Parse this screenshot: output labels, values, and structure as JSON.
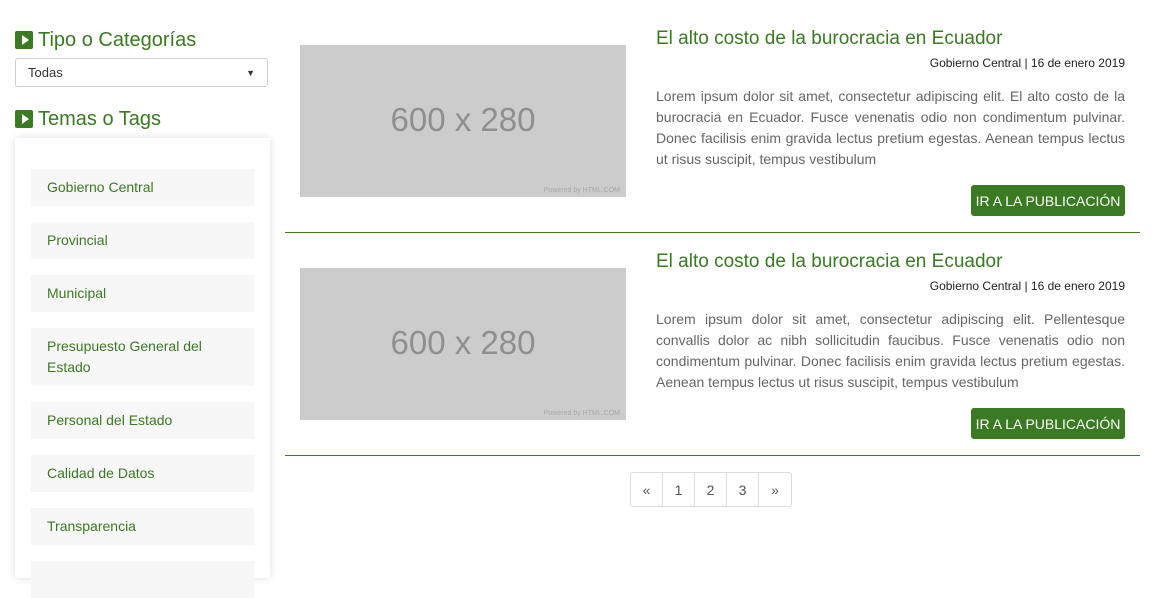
{
  "sidebar": {
    "categories_heading": "Tipo o Categorías",
    "category_select": {
      "value": "Todas"
    },
    "tags_heading": "Temas o Tags",
    "tags": [
      "Gobierno Central",
      "Provincial",
      "Municipal",
      "Presupuesto General del Estado",
      "Personal del Estado",
      "Calidad de Datos",
      "Transparencia"
    ]
  },
  "posts": [
    {
      "image_placeholder": "600 x 280",
      "image_credit": "Powered by HTML.COM",
      "title": "El alto costo de la burocracia en Ecuador",
      "meta": "Gobierno Central | 16 de enero 2019",
      "excerpt": "Lorem ipsum dolor sit amet, consectetur adipiscing elit. El alto costo de la burocracia en Ecuador. Fusce venenatis odio non condimentum pulvinar. Donec facilisis enim gravida lectus pretium egestas. Aenean tempus lectus ut risus suscipit, tempus vestibulum",
      "button": "IR A LA PUBLICACIÓN"
    },
    {
      "image_placeholder": "600 x 280",
      "image_credit": "Powered by HTML.COM",
      "title": "El alto costo de la burocracia en Ecuador",
      "meta": "Gobierno Central | 16 de enero 2019",
      "excerpt": "Lorem ipsum dolor sit amet, consectetur adipiscing elit. Pellentesque convallis dolor ac nibh sollicitudin faucibus. Fusce venenatis odio non condimentum pulvinar. Donec facilisis enim gravida lectus pretium egestas. Aenean tempus lectus ut risus suscipit, tempus vestibulum",
      "button": "IR A LA PUBLICACIÓN"
    }
  ],
  "pagination": {
    "prev": "«",
    "pages": [
      "1",
      "2",
      "3"
    ],
    "next": "»"
  },
  "colors": {
    "accent": "#3a7a22",
    "placeholder": "#cccccc",
    "tag_bg": "#f7f7f7"
  }
}
